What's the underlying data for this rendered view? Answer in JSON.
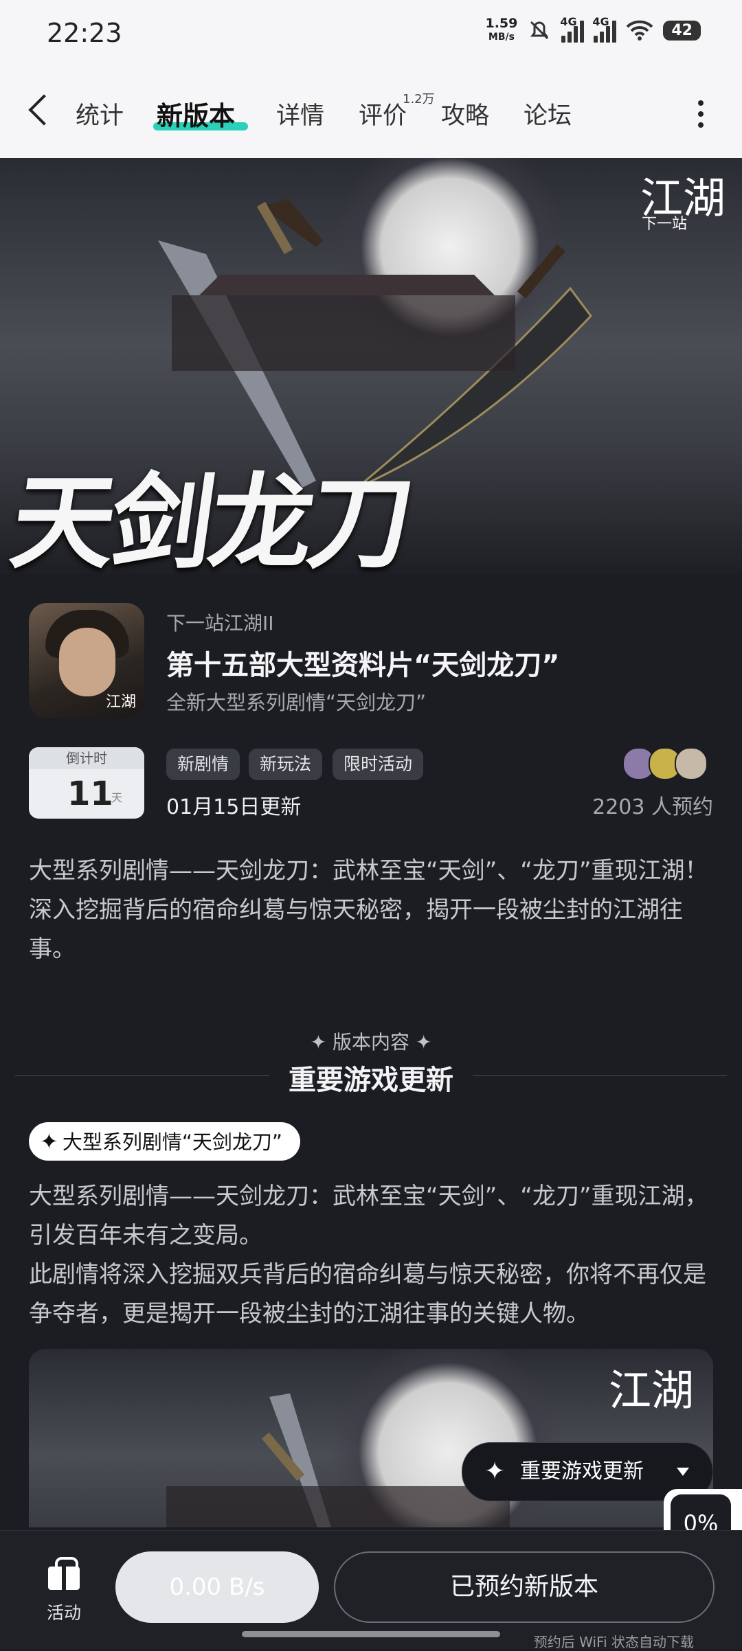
{
  "status_bar": {
    "time": "22:23",
    "net_speed_value": "1.59",
    "net_speed_unit": "MB/s",
    "sim1": "4G",
    "sim2": "4G",
    "battery": "42"
  },
  "nav": {
    "tabs": [
      {
        "label": "统计"
      },
      {
        "label": "新版本",
        "active": true
      },
      {
        "label": "详情"
      },
      {
        "label": "评价",
        "count": "1.2万"
      },
      {
        "label": "攻略"
      },
      {
        "label": "论坛"
      }
    ],
    "accent_color": "#2ad1b8"
  },
  "banner": {
    "title_art": "天剑龙刀",
    "logo": "江湖",
    "logo_sub": "下一站"
  },
  "info": {
    "app_icon_text": "江湖",
    "game_name": "下一站江湖II",
    "headline": "第十五部大型资料片“天剑龙刀”",
    "subline": "全新大型系列剧情“天剑龙刀”",
    "countdown_label": "倒计时",
    "countdown_value": "11",
    "countdown_unit": "天",
    "tags": [
      "新剧情",
      "新玩法",
      "限时活动"
    ],
    "update_date": "01月15日更新",
    "reservations": "2203 人预约"
  },
  "description": "大型系列剧情——天剑龙刀：武林至宝“天剑”、“龙刀”重现江湖！深入挖掘背后的宿命纠葛与惊天秘密，揭开一段被尘封的江湖往事。",
  "section": {
    "small_title": "✦ 版本内容 ✦",
    "title": "重要游戏更新",
    "pill": "大型系列剧情“天剑龙刀”",
    "body": "大型系列剧情——天剑龙刀：武林至宝“天剑”、“龙刀”重现江湖，引发百年未有之变局。\n此剧情将深入挖掘双兵背后的宿命纠葛与惊天秘密，你将不再仅是争夺者，更是揭开一段被尘封的江湖往事的关键人物。",
    "banner_logo": "江湖"
  },
  "float_menu": {
    "label": "重要游戏更新"
  },
  "progress": {
    "value": "0%"
  },
  "bottom": {
    "activity_label": "活动",
    "speed": "0.00 B/s",
    "reserved_button": "已预约新版本",
    "wifi_note": "预约后 WiFi 状态自动下载"
  }
}
